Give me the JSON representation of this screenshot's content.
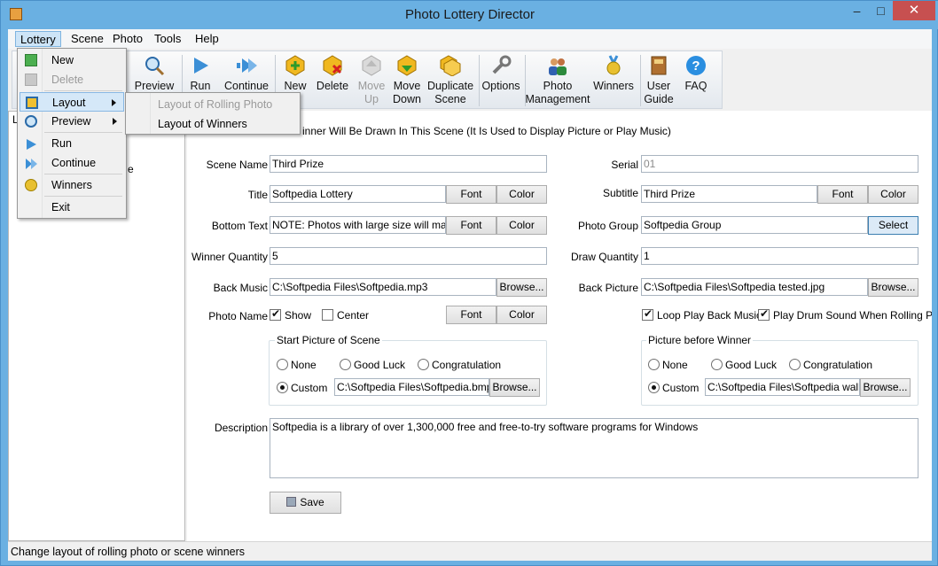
{
  "window": {
    "title": "Photo Lottery Director",
    "min": "–",
    "max": "□",
    "close": "✕"
  },
  "menubar": [
    "Lottery",
    "Scene",
    "Photo",
    "Tools",
    "Help"
  ],
  "toolbar": {
    "preview": "Preview",
    "run": "Run",
    "continue": "Continue",
    "new": "New",
    "delete": "Delete",
    "move_up": [
      "Move",
      "Up"
    ],
    "move_down": [
      "Move",
      "Down"
    ],
    "duplicate": [
      "Duplicate",
      "Scene"
    ],
    "options": "Options",
    "photo_mgmt": [
      "Photo",
      "Management"
    ],
    "winners": "Winners",
    "user_guide": [
      "User",
      "Guide"
    ],
    "faq": "FAQ"
  },
  "lottery_menu": {
    "new": "New",
    "delete": "Delete",
    "layout": "Layout",
    "preview": "Preview",
    "run": "Run",
    "continue": "Continue",
    "winners": "Winners",
    "exit": "Exit"
  },
  "layout_submenu": {
    "rolling": "Layout of Rolling Photo",
    "winners": "Layout of Winners"
  },
  "tree": {
    "header": "L",
    "item_suffix": "e"
  },
  "form": {
    "header_text": "inner Will Be Drawn In This Scene   (It Is Used to Display Picture or Play Music)",
    "scene_name_label": "Scene Name",
    "scene_name": "Third Prize",
    "serial_label": "Serial",
    "serial": "01",
    "title_label": "Title",
    "title": "Softpedia Lottery",
    "subtitle_label": "Subtitle",
    "subtitle": "Third Prize",
    "font_btn": "Font",
    "color_btn": "Color",
    "bottom_text_label": "Bottom Text",
    "bottom_text": "NOTE: Photos with large size will make p",
    "photo_group_label": "Photo Group",
    "photo_group": "Softpedia Group",
    "select_btn": "Select",
    "winner_qty_label": "Winner Quantity",
    "winner_qty": "5",
    "draw_qty_label": "Draw Quantity",
    "draw_qty": "1",
    "back_music_label": "Back Music",
    "back_music": "C:\\Softpedia Files\\Softpedia.mp3",
    "browse_btn": "Browse...",
    "back_picture_label": "Back Picture",
    "back_picture": "C:\\Softpedia Files\\Softpedia tested.jpg",
    "photo_name_label": "Photo Name",
    "show": "Show",
    "center": "Center",
    "loop_music": "Loop Play Back Music",
    "play_drum": "Play Drum Sound When Rolling Photos",
    "start_picture_title": "Start Picture of Scene",
    "picture_before_title": "Picture before Winner",
    "opt_none": "None",
    "opt_good_luck": "Good Luck",
    "opt_congrats": "Congratulation",
    "opt_custom": "Custom",
    "start_custom_path": "C:\\Softpedia Files\\Softpedia.bmp",
    "before_custom_path": "C:\\Softpedia Files\\Softpedia wallpaper",
    "description_label": "Description",
    "description": "Softpedia is a library of over 1,300,000 free and free-to-try software programs for Windows",
    "save_btn": "Save"
  },
  "status": "Change layout of rolling photo or scene winners",
  "colors": {
    "titlebar": "#6ab0e2",
    "close": "#c75050",
    "highlight": "#d5e8f8"
  }
}
